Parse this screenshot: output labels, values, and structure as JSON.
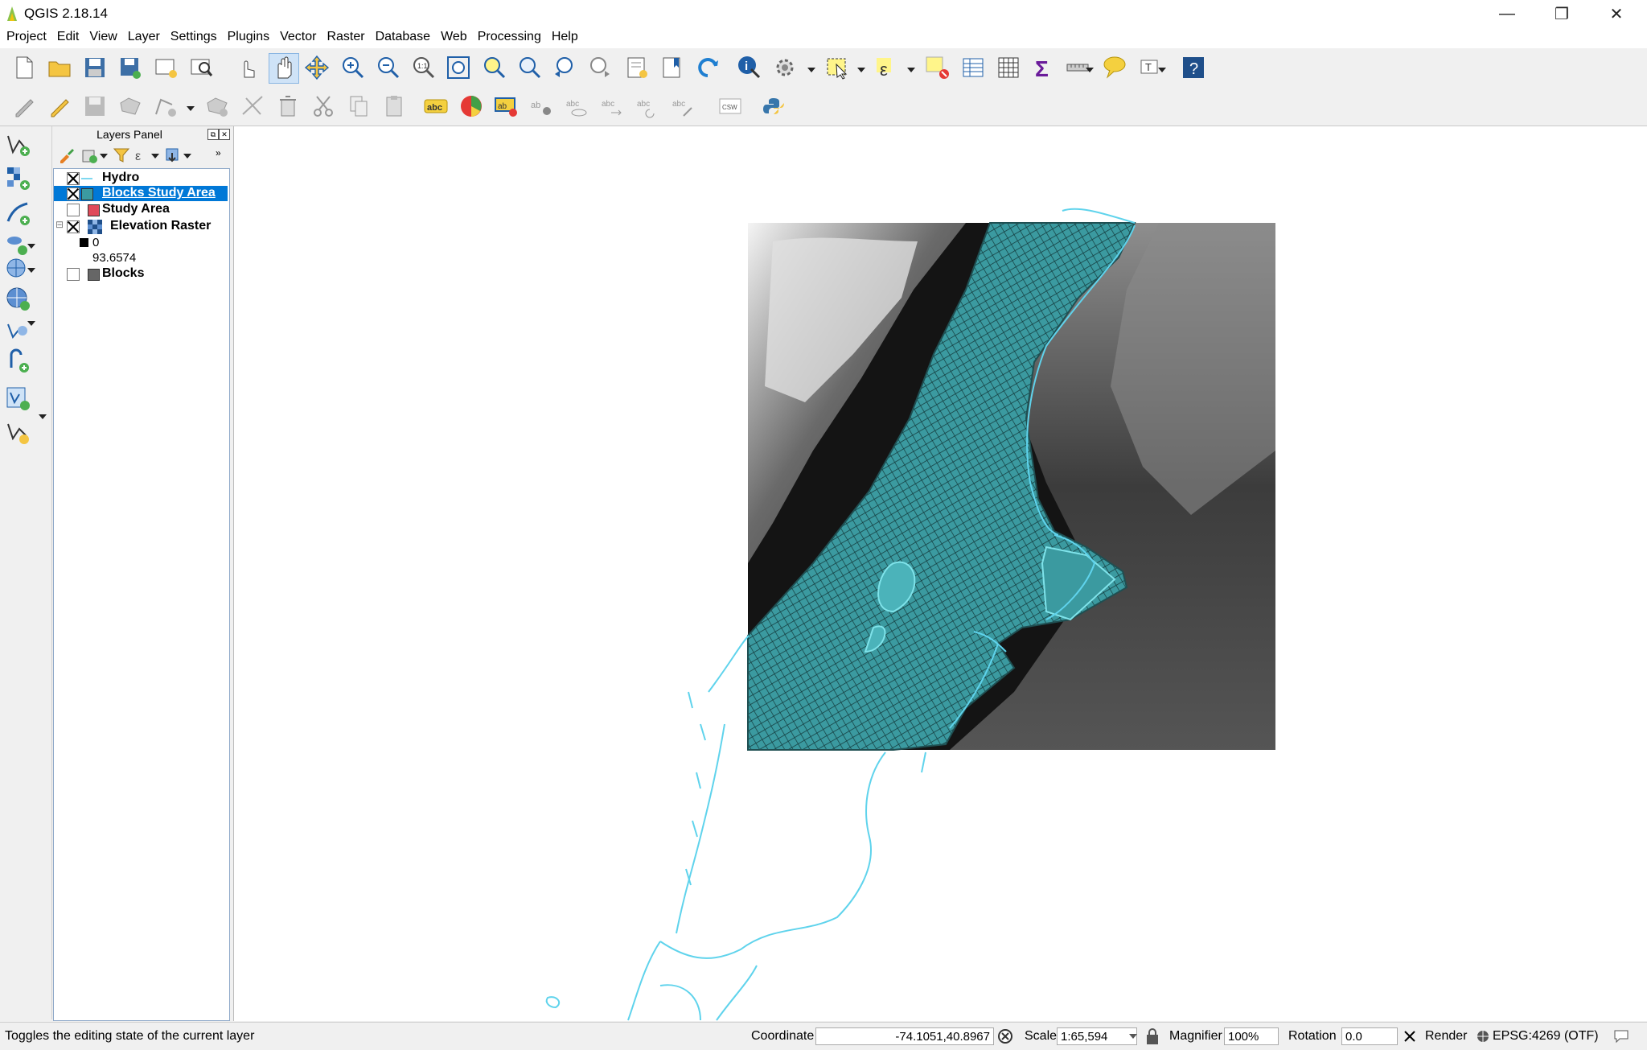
{
  "window": {
    "title": "QGIS 2.18.14",
    "controls": {
      "minimize": "—",
      "restore": "❐",
      "close": "✕"
    }
  },
  "menu": [
    "Project",
    "Edit",
    "View",
    "Layer",
    "Settings",
    "Plugins",
    "Vector",
    "Raster",
    "Database",
    "Web",
    "Processing",
    "Help"
  ],
  "toolbar2": {
    "csw_label": "CSW"
  },
  "layers_panel": {
    "title": "Layers Panel",
    "float_symbol": "⧉",
    "close_symbol": "✕",
    "layers": [
      {
        "name": "Hydro",
        "checked": true,
        "selected": false,
        "symbol": "line",
        "color": "#7fd8f0"
      },
      {
        "name": "Blocks Study Area",
        "checked": true,
        "selected": true,
        "symbol": "fill",
        "color": "#3b9aa0"
      },
      {
        "name": "Study Area",
        "checked": false,
        "selected": false,
        "symbol": "fill",
        "color": "#e04a5a"
      },
      {
        "name": "Elevation Raster",
        "checked": true,
        "selected": false,
        "symbol": "raster",
        "expand": "⊟"
      },
      {
        "name": "Blocks",
        "checked": false,
        "selected": false,
        "symbol": "fill",
        "color": "#666666"
      }
    ],
    "raster_legend": {
      "min": "0",
      "max": "93.6574"
    }
  },
  "status": {
    "message": "Toggles the editing state of the current layer",
    "coordinate_label": "Coordinate",
    "coordinate_value": "-74.1051,40.8967",
    "scale_label": "Scale",
    "scale_value": "1:65,594",
    "magnifier_label": "Magnifier",
    "magnifier_value": "100%",
    "rotation_label": "Rotation",
    "rotation_value": "0.0",
    "render_label": "Render",
    "crs": "EPSG:4269 (OTF)"
  },
  "colors": {
    "blocks_fill": "#3b9aa0",
    "hydro_line": "#5fd3ec",
    "selection": "#0078d7"
  }
}
